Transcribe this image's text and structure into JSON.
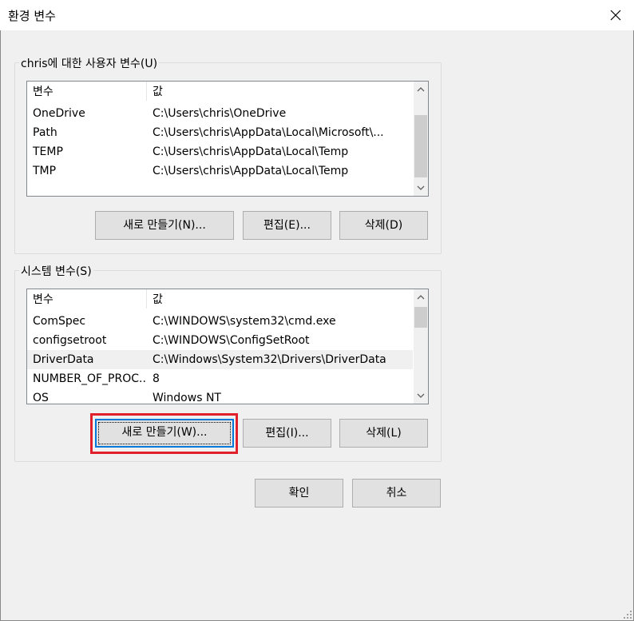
{
  "window": {
    "title": "환경 변수"
  },
  "user_vars": {
    "group_label": "chris에 대한 사용자 변수(U)",
    "columns": [
      "변수",
      "값"
    ],
    "rows": [
      {
        "name": "OneDrive",
        "value": "C:\\Users\\chris\\OneDrive"
      },
      {
        "name": "Path",
        "value": "C:\\Users\\chris\\AppData\\Local\\Microsoft\\..."
      },
      {
        "name": "TEMP",
        "value": "C:\\Users\\chris\\AppData\\Local\\Temp"
      },
      {
        "name": "TMP",
        "value": "C:\\Users\\chris\\AppData\\Local\\Temp"
      }
    ],
    "buttons": {
      "new": "새로 만들기(N)...",
      "edit": "편집(E)...",
      "delete": "삭제(D)"
    }
  },
  "system_vars": {
    "group_label": "시스템 변수(S)",
    "columns": [
      "변수",
      "값"
    ],
    "rows": [
      {
        "name": "ComSpec",
        "value": "C:\\WINDOWS\\system32\\cmd.exe"
      },
      {
        "name": "configsetroot",
        "value": "C:\\WINDOWS\\ConfigSetRoot"
      },
      {
        "name": "DriverData",
        "value": "C:\\Windows\\System32\\Drivers\\DriverData"
      },
      {
        "name": "NUMBER_OF_PROC...",
        "value": "8"
      },
      {
        "name": "OS",
        "value": "Windows NT"
      }
    ],
    "selected_row": 2,
    "buttons": {
      "new": "새로 만들기(W)...",
      "edit": "편집(I)...",
      "delete": "삭제(L)"
    }
  },
  "footer": {
    "ok": "확인",
    "cancel": "취소"
  },
  "colors": {
    "accent": "#0078d7",
    "highlight": "#e0202a"
  }
}
